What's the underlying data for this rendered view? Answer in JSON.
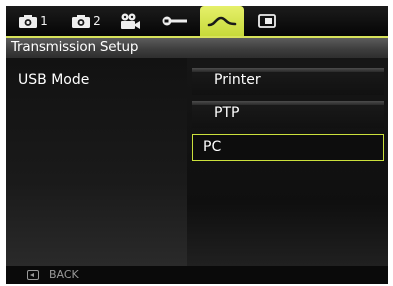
{
  "tabs": [
    {
      "icon": "camera-icon",
      "number": "1"
    },
    {
      "icon": "camera-icon",
      "number": "2"
    },
    {
      "icon": "movie-camera-icon",
      "number": ""
    },
    {
      "icon": "wrench-icon",
      "number": ""
    },
    {
      "icon": "connection-icon",
      "number": "",
      "active": true
    },
    {
      "icon": "playback-card-icon",
      "number": ""
    }
  ],
  "header": {
    "title": "Transmission Setup"
  },
  "setting": {
    "label": "USB Mode",
    "options": [
      "Printer",
      "PTP",
      "PC"
    ],
    "selected": "PC"
  },
  "footer": {
    "back_label": "BACK"
  },
  "colors": {
    "accent": "#cbe03c",
    "background": "#0b0b0b"
  }
}
